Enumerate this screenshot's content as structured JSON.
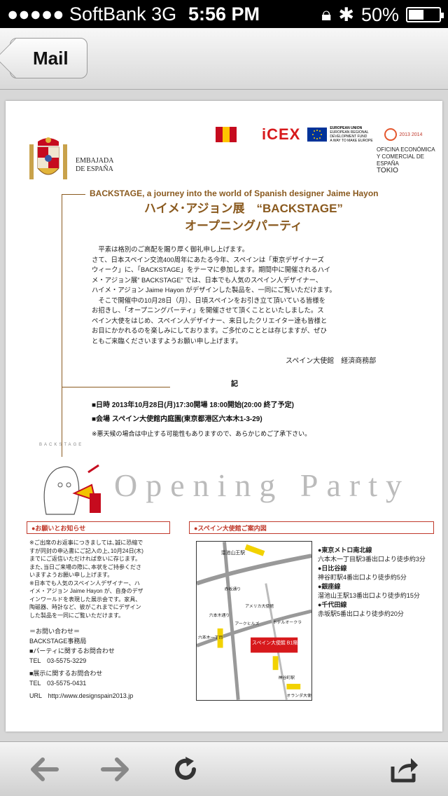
{
  "status_bar": {
    "carrier": "●●●●● SoftBank 3G",
    "time": "5:56 PM",
    "battery": "50%",
    "battery_level": 0.5
  },
  "nav": {
    "back_label": "Mail"
  },
  "document": {
    "embassy": [
      "EMBAJADA",
      "DE ESPAÑA"
    ],
    "logo_icex": "iCEX",
    "logo_eu_text": "EUROPEAN UNION",
    "logo_eu_sub": "EUROPEAN REGIONAL DEVELOPMENT FUND",
    "logo_eu_slogan": "A WAY TO MAKE EUROPE",
    "logo_year": "2013 2014",
    "oficina": [
      "OFICINA ECONÓMICA",
      "Y COMERCIAL DE ESPAÑA",
      "TOKIO"
    ],
    "headline_en": "BACKSTAGE, a journey into the world of Spanish designer Jaime Hayon",
    "headline_jp1": "ハイメ･アジョン展　“BACKSTAGE”",
    "headline_jp2": "オープニングパーティ",
    "body": "　平素は格別のご高配を賜り厚く御礼申し上げます。\nさて、日本スペイン交流400周年にあたる今年、スペインは「東京デザイナーズ\nウィーク」に、「BACKSTAGE」をテーマに参加します。期間中に開催されるハイ\nメ・アジョン展” BACKSTAGE” では、日本でも人気のスペイン人デザイナー、\nハイメ・アジョン Jaime Hayon がデザインした製品を、一同にご覧いただけます。\n　そこで開催中の10月28日（月）、日頃スペインをお引き立て頂いている皆様を\nお招きし、「オープニングパーティ」を開催させて頂くことといたしました。ス\nペイン大使をはじめ、スペイン人デザイナー、来日したクリエイター達も皆様と\nお目にかかれるのを楽しみにしております。ご多忙のこととは存じますが、ぜひ\nともご来臨くださいますようお願い申し上げます。",
    "signature": "スペイン大使館　経済商務部",
    "ki": "記",
    "date_line": "■日時  2013年10月28日(月)17:30開場  18:00開始(20:00 終了予定)",
    "venue_line": "■会場  スペイン大使館内庭園(東京都港区六本木1-3-29)",
    "rain_note": "※悪天候の場合は中止する可能性もありますので、あらかじめご了承下さい。",
    "backstage_mini": "BACKSTAGE",
    "opening_party": "Opening Party",
    "notice_title": "●お願いとお知らせ",
    "notice_body": "※ご出席のお返事につきましては､誠に恐縮で\nすが同封の申込書にご記入の上､10月24日(木)\nまでにご返信いただければ幸いに存じます。\nまた､当日ご来場の際に､本状をご持参くださ\nいますようお願い申し上げます。\n※日本でも人気のスペイン人デザイナー、ハ\nイメ・アジョン Jaime Hayon が、自身のデザ\nインワールドを表現した展示会です。家具、\n陶磁器、時計など、彼がこれまでにデザイン\nした製品を一同にご覧いただけます。",
    "contact_title": "＝お問い合わせ＝",
    "contact_office": "BACKSTAGE事務局",
    "contact_party": "■パーティに関するお問合わせ",
    "contact_party_tel": "TEL　03-5575-3229",
    "contact_exhibit": "■展示に関するお問合わせ",
    "contact_exhibit_tel": "TEL　03-5575-0431",
    "contact_url": "URL　http://www.designspain2013.jp",
    "map_title": "●スペイン大使館ご案内図",
    "map_labels": {
      "tameike": "溜池山王駅",
      "akasaka": "赤坂通り",
      "american": "アメリカ大使館",
      "roppongi_dori": "六本木通り",
      "ark": "アークヒルズ",
      "okura": "ホテルオークラ",
      "spain": "スペイン大使館 B1階 セミナールーム",
      "roppongi1": "六本木一丁目",
      "kamiyacho": "神谷町駅",
      "oranda": "オランダ大使館"
    },
    "access": [
      {
        "line": "●東京メトロ南北線",
        "detail": "六本木一丁目駅3番出口より徒歩約3分"
      },
      {
        "line": "●日比谷線",
        "detail": "神谷町駅4番出口より徒歩約5分"
      },
      {
        "line": "●銀座線",
        "detail": "溜池山王駅13番出口より徒歩約15分"
      },
      {
        "line": "●千代田線",
        "detail": "赤坂駅5番出口より徒歩約20分"
      }
    ]
  },
  "toolbar": {
    "back_icon": "arrow-left-icon",
    "forward_icon": "arrow-right-icon",
    "reload_icon": "reload-icon",
    "share_icon": "share-icon"
  }
}
